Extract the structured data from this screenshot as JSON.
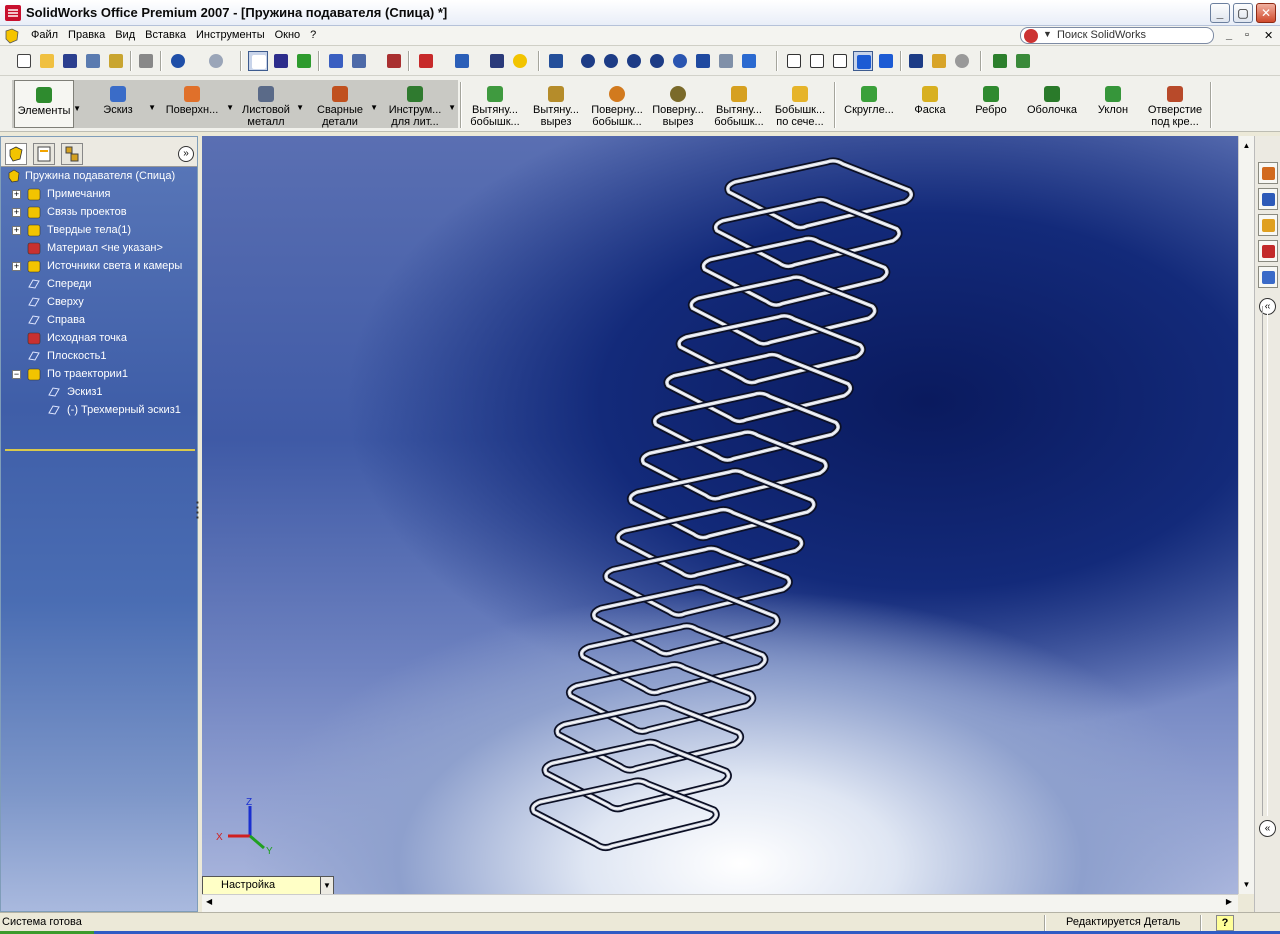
{
  "window": {
    "title": "SolidWorks Office Premium 2007 - [Пружина подавателя (Спица) *]",
    "buttons": {
      "minimize": "_",
      "maximize": "▢",
      "close": "✕"
    }
  },
  "menu": {
    "items": [
      "Файл",
      "Правка",
      "Вид",
      "Вставка",
      "Инструменты",
      "Окно",
      "?"
    ],
    "search_placeholder": "Поиск SolidWorks",
    "mdi": {
      "minimize": "_",
      "restore": "▫",
      "close": "✕"
    }
  },
  "command_manager": {
    "tabs": [
      {
        "label": "Элементы",
        "icon": "features-icon"
      },
      {
        "label": "Эскиз",
        "icon": "sketch-icon"
      },
      {
        "label": "Поверхн...",
        "icon": "surfaces-icon"
      },
      {
        "label": "Листовой металл",
        "line1": "Листовой",
        "line2": "металл",
        "icon": "sheet-metal-icon"
      },
      {
        "label": "Сварные детали",
        "line1": "Сварные",
        "line2": "детали",
        "icon": "weldments-icon"
      },
      {
        "label": "Инструм... для лит...",
        "line1": "Инструм...",
        "line2": "для лит...",
        "icon": "mold-tools-icon"
      }
    ],
    "tools": [
      {
        "line1": "Вытяну...",
        "line2": "бобышк...",
        "icon": "extruded-boss-icon"
      },
      {
        "line1": "Вытяну...",
        "line2": "вырез",
        "icon": "extruded-cut-icon"
      },
      {
        "line1": "Поверну...",
        "line2": "бобышк...",
        "icon": "revolved-boss-icon"
      },
      {
        "line1": "Поверну...",
        "line2": "вырез",
        "icon": "revolved-cut-icon"
      },
      {
        "line1": "Вытяну...",
        "line2": "бобышк...",
        "icon": "swept-boss-icon"
      },
      {
        "line1": "Бобышк...",
        "line2": "по сече...",
        "icon": "lofted-boss-icon"
      },
      {
        "line1": "Скругле...",
        "line2": "",
        "icon": "fillet-icon"
      },
      {
        "line1": "Фаска",
        "line2": "",
        "icon": "chamfer-icon"
      },
      {
        "line1": "Ребро",
        "line2": "",
        "icon": "rib-icon"
      },
      {
        "line1": "Оболочка",
        "line2": "",
        "icon": "shell-icon"
      },
      {
        "line1": "Уклон",
        "line2": "",
        "icon": "draft-icon"
      },
      {
        "line1": "Отверстие",
        "line2": "под кре...",
        "icon": "hole-wizard-icon"
      }
    ]
  },
  "feature_tree": {
    "root": "Пружина подавателя (Спица)",
    "nodes": [
      {
        "label": "Примечания",
        "expander": "+",
        "icon": "annotations-icon"
      },
      {
        "label": "Связь проектов",
        "expander": "+",
        "icon": "design-binder-icon"
      },
      {
        "label": "Твердые тела(1)",
        "expander": "+",
        "icon": "solid-bodies-icon"
      },
      {
        "label": "Материал <не указан>",
        "expander": "",
        "icon": "material-icon"
      },
      {
        "label": "Источники света и камеры",
        "expander": "+",
        "icon": "lights-cameras-icon"
      },
      {
        "label": "Спереди",
        "expander": "",
        "icon": "plane-icon"
      },
      {
        "label": "Сверху",
        "expander": "",
        "icon": "plane-icon"
      },
      {
        "label": "Справа",
        "expander": "",
        "icon": "plane-icon"
      },
      {
        "label": "Исходная точка",
        "expander": "",
        "icon": "origin-icon"
      },
      {
        "label": "Плоскость1",
        "expander": "",
        "icon": "plane-icon"
      },
      {
        "label": "По траектории1",
        "expander": "−",
        "icon": "sweep-feature-icon"
      },
      {
        "label": "Эскиз1",
        "expander": "",
        "icon": "sketch-feature-icon"
      },
      {
        "label": "(-) Трехмерный эскиз1",
        "expander": "",
        "icon": "3d-sketch-icon"
      }
    ],
    "expand_button": "»"
  },
  "viewport": {
    "configuration": "Настройка",
    "triad": {
      "x": "X",
      "y": "Y",
      "z": "Z"
    },
    "spring_coils": 17
  },
  "taskpane": {
    "collapse": "«"
  },
  "status": {
    "left": "Система готова",
    "right": "Редактируется Деталь",
    "help": "?"
  },
  "colors": {
    "accent_blue": "#3f5aa6",
    "tree_text": "#ffffff",
    "config_box": "#ffffc6"
  }
}
